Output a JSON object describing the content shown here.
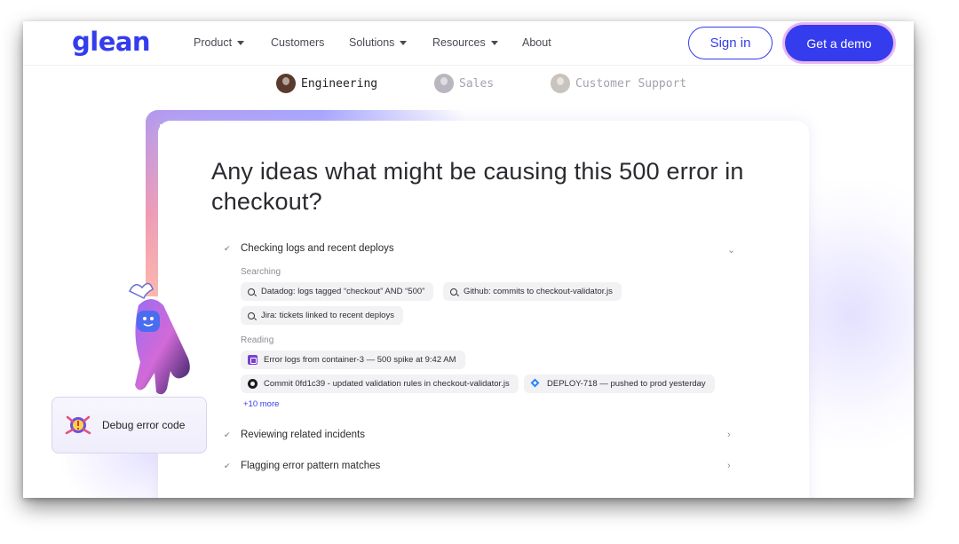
{
  "nav": {
    "logo": "glean",
    "items": [
      {
        "label": "Product",
        "dropdown": true
      },
      {
        "label": "Customers",
        "dropdown": false
      },
      {
        "label": "Solutions",
        "dropdown": true
      },
      {
        "label": "Resources",
        "dropdown": true
      },
      {
        "label": "About",
        "dropdown": false
      }
    ],
    "sign_in": "Sign in",
    "get_demo": "Get a demo"
  },
  "personas": [
    {
      "label": "Engineering",
      "active": true
    },
    {
      "label": "Sales",
      "active": false
    },
    {
      "label": "Customer Support",
      "active": false
    }
  ],
  "chat": {
    "question": "Any ideas what might be causing this 500 error in checkout?",
    "steps": [
      {
        "label": "Checking logs and recent deploys",
        "expanded": true
      },
      {
        "label": "Reviewing related incidents",
        "expanded": false
      },
      {
        "label": "Flagging error pattern matches",
        "expanded": false
      }
    ],
    "searching_label": "Searching",
    "searches": [
      "Datadog: logs tagged “checkout” AND “500”",
      "Github: commits to checkout-validator.js",
      "Jira: tickets linked to recent deploys"
    ],
    "reading_label": "Reading",
    "reading": [
      {
        "icon": "log-icon",
        "text": "Error logs from container-3 — 500 spike at 9:42 AM"
      },
      {
        "icon": "github-icon",
        "text": "Commit 0fd1c39 - updated validation rules in checkout-validator.js"
      },
      {
        "icon": "jira-icon",
        "text": "DEPLOY-718 — pushed to prod yesterday"
      }
    ],
    "more": "+10 more"
  },
  "debug_card": {
    "label": "Debug error code"
  },
  "colors": {
    "brand": "#343ced",
    "demo_ring": "#e9b8f2",
    "gradient_start": "#b39af0",
    "gradient_end": "#ffb7a8"
  }
}
